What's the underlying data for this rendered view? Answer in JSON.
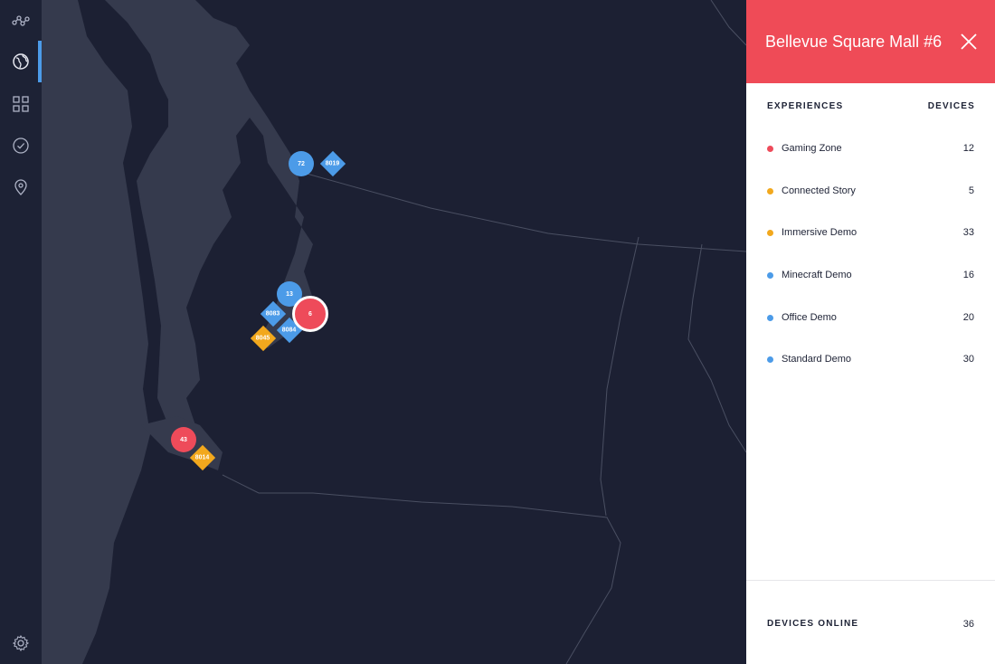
{
  "sidebar": {
    "items": [
      {
        "icon": "network-icon",
        "active": false
      },
      {
        "icon": "globe-icon",
        "active": true
      },
      {
        "icon": "grid-icon",
        "active": false
      },
      {
        "icon": "check-circle-icon",
        "active": false
      },
      {
        "icon": "location-pin-icon",
        "active": false
      }
    ],
    "settings_icon": "gear-icon"
  },
  "map": {
    "markers": [
      {
        "label": "72",
        "shape": "circle",
        "color": "blue"
      },
      {
        "label": "8019",
        "shape": "diamond",
        "color": "blue"
      },
      {
        "label": "13",
        "shape": "circle",
        "color": "blue"
      },
      {
        "label": "8083",
        "shape": "diamond",
        "color": "blue"
      },
      {
        "label": "6",
        "shape": "circle",
        "color": "red",
        "selected": true
      },
      {
        "label": "8084",
        "shape": "diamond",
        "color": "blue"
      },
      {
        "label": "8045",
        "shape": "diamond",
        "color": "orange"
      },
      {
        "label": "43",
        "shape": "circle",
        "color": "red"
      },
      {
        "label": "8014",
        "shape": "diamond",
        "color": "orange"
      }
    ]
  },
  "panel": {
    "title": "Bellevue Square Mall #6",
    "col_experiences": "EXPERIENCES",
    "col_devices": "DEVICES",
    "rows": [
      {
        "name": "Gaming Zone",
        "count": "12",
        "color": "#ee4b5a"
      },
      {
        "name": "Connected Story",
        "count": "5",
        "color": "#f2a81d"
      },
      {
        "name": "Immersive Demo",
        "count": "33",
        "color": "#f2a81d"
      },
      {
        "name": "Minecraft Demo",
        "count": "16",
        "color": "#4c9be8"
      },
      {
        "name": "Office Demo",
        "count": "20",
        "color": "#4c9be8"
      },
      {
        "name": "Standard Demo",
        "count": "30",
        "color": "#4c9be8"
      }
    ],
    "footer_label": "DEVICES ONLINE",
    "footer_count": "36"
  },
  "colors": {
    "accent_blue": "#4c9be8",
    "accent_red": "#ee4b5a",
    "accent_orange": "#f2a81d",
    "background": "#1c2033"
  }
}
